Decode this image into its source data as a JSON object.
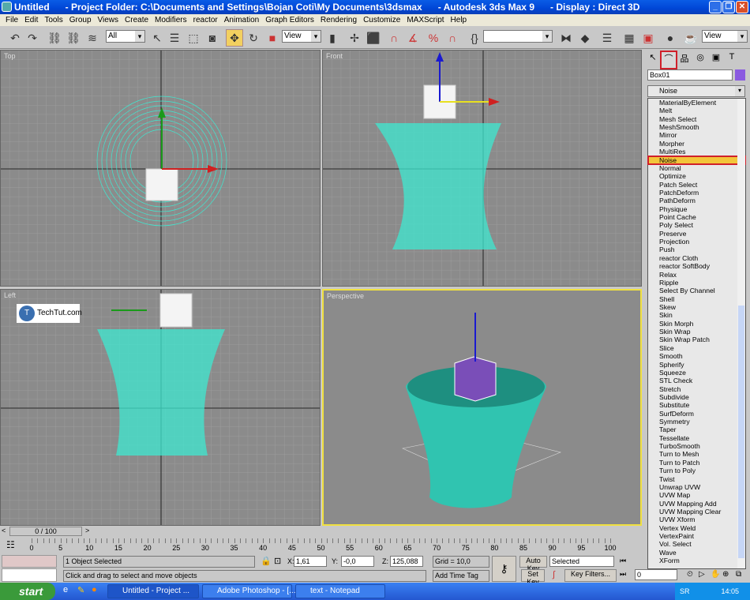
{
  "window": {
    "title": "Untitled      - Project Folder: C:\\Documents and Settings\\Bojan Coti\\My Documents\\3dsmax      - Autodesk 3ds Max 9      - Display : Direct 3D"
  },
  "menu": [
    "File",
    "Edit",
    "Tools",
    "Group",
    "Views",
    "Create",
    "Modifiers",
    "reactor",
    "Animation",
    "Graph Editors",
    "Rendering",
    "Customize",
    "MAXScript",
    "Help"
  ],
  "toolbar": {
    "selection_filter": "All",
    "ref_coord": "View",
    "named_selection": "",
    "render_view": "View"
  },
  "viewports": {
    "top": "Top",
    "front": "Front",
    "left": "Left",
    "perspective": "Perspective",
    "watermark": "TechTut.com"
  },
  "command_panel": {
    "object_name": "Box01",
    "object_color": "#8a5ae0",
    "modifier_dropdown": "Noise",
    "modifiers": [
      "MaterialByElement",
      "Melt",
      "Mesh Select",
      "MeshSmooth",
      "Mirror",
      "Morpher",
      "MultiRes",
      "Noise",
      "Normal",
      "Optimize",
      "Patch Select",
      "PatchDeform",
      "PathDeform",
      "Physique",
      "Point Cache",
      "Poly Select",
      "Preserve",
      "Projection",
      "Push",
      "reactor Cloth",
      "reactor SoftBody",
      "Relax",
      "Ripple",
      "Select By Channel",
      "Shell",
      "Skew",
      "Skin",
      "Skin Morph",
      "Skin Wrap",
      "Skin Wrap Patch",
      "Slice",
      "Smooth",
      "Spherify",
      "Squeeze",
      "STL Check",
      "Stretch",
      "Subdivide",
      "Substitute",
      "SurfDeform",
      "Symmetry",
      "Taper",
      "Tessellate",
      "TurboSmooth",
      "Turn to Mesh",
      "Turn to Patch",
      "Turn to Poly",
      "Twist",
      "Unwrap UVW",
      "UVW Map",
      "UVW Mapping Add",
      "UVW Mapping Clear",
      "UVW Xform",
      "Vertex Weld",
      "VertexPaint",
      "Vol. Select",
      "Wave",
      "XForm"
    ],
    "highlighted": "Noise"
  },
  "timeline": {
    "frame": "0 / 100",
    "labels": [
      "0",
      "5",
      "10",
      "15",
      "20",
      "25",
      "30",
      "35",
      "40",
      "45",
      "50",
      "55",
      "60",
      "65",
      "70",
      "75",
      "80",
      "85",
      "90",
      "95",
      "100"
    ]
  },
  "status": {
    "selected": "1 Object Selected",
    "prompt": "Click and drag to select and move objects",
    "x_label": "X:",
    "x": "1,61",
    "y_label": "Y:",
    "y": "-0,0",
    "z_label": "Z:",
    "z": "125,088",
    "grid": "Grid = 10,0",
    "add_time_tag": "Add Time Tag",
    "auto_key": "Auto Key",
    "set_key": "Set Key",
    "key_mode": "Selected",
    "key_filters": "Key Filters...",
    "current_frame": "0"
  },
  "taskbar": {
    "start": "start",
    "tasks": [
      "Untitled      - Project ...",
      "Adobe Photoshop - [...",
      "text - Notepad"
    ],
    "lang": "SR",
    "clock": "14:05"
  }
}
